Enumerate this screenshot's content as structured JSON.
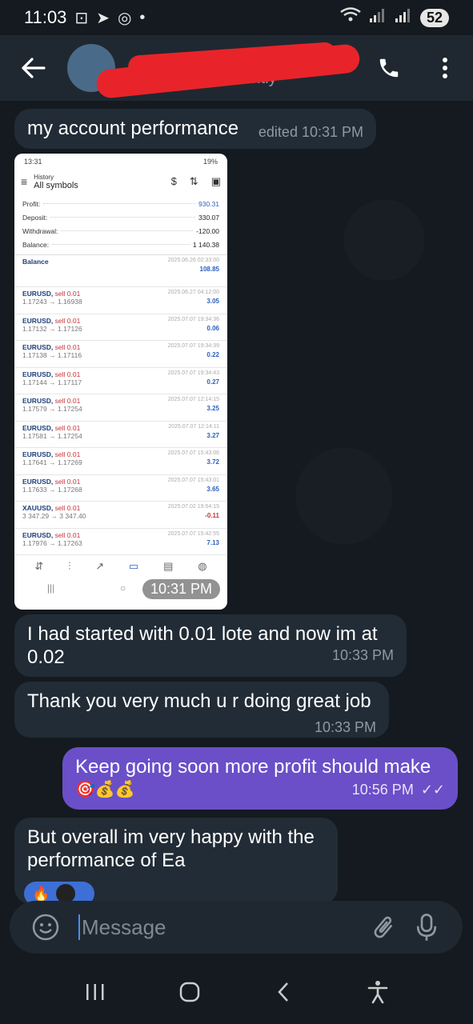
{
  "status_bar": {
    "time": "11:03",
    "battery": "52"
  },
  "header": {
    "last_seen": "last seen recently"
  },
  "messages": [
    {
      "text": "my account performance",
      "time": "edited 10:31 PM"
    },
    {
      "text": "I had started with 0.01 lote and now im at 0.02",
      "time": "10:33 PM"
    },
    {
      "text": "Thank you very much u r doing great job",
      "time": "10:33 PM"
    },
    {
      "text": "Keep going soon more profit should make",
      "emoji": "🎯💰💰",
      "time": "10:56 PM"
    },
    {
      "text": "But overall im very happy with the performance of Ea"
    }
  ],
  "photo": {
    "time": "10:31 PM",
    "status_time": "13:31",
    "status_right": "19%",
    "title_small": "History",
    "title": "All symbols",
    "summary": [
      {
        "label": "Profit:",
        "value": "930.31"
      },
      {
        "label": "Deposit:",
        "value": "330.07"
      },
      {
        "label": "Withdrawal:",
        "value": "-120.00"
      },
      {
        "label": "Balance:",
        "value": "1 140.38"
      }
    ],
    "balance_row": {
      "label": "Balance",
      "date": "2025.06.26 02:33:00",
      "value": "108.85"
    },
    "trades": [
      {
        "sym": "EURUSD,",
        "side": "sell 0.01",
        "prices": "1.17243 → 1.16938",
        "date": "2025.06.27 04:12:00",
        "profit": "3.05"
      },
      {
        "sym": "EURUSD,",
        "side": "sell 0.01",
        "prices": "1.17132 → 1.17126",
        "date": "2025.07.07 19:34:36",
        "profit": "0.06"
      },
      {
        "sym": "EURUSD,",
        "side": "sell 0.01",
        "prices": "1.17138 → 1.17116",
        "date": "2025.07.07 19:34:39",
        "profit": "0.22"
      },
      {
        "sym": "EURUSD,",
        "side": "sell 0.01",
        "prices": "1.17144 → 1.17117",
        "date": "2025.07.07 19:34:43",
        "profit": "0.27"
      },
      {
        "sym": "EURUSD,",
        "side": "sell 0.01",
        "prices": "1.17579 → 1.17254",
        "date": "2025.07.07 12:14:15",
        "profit": "3.25"
      },
      {
        "sym": "EURUSD,",
        "side": "sell 0.01",
        "prices": "1.17581 → 1.17254",
        "date": "2025.07.07 12:14:11",
        "profit": "3.27"
      },
      {
        "sym": "EURUSD,",
        "side": "sell 0.01",
        "prices": "1.17641 → 1.17269",
        "date": "2025.07.07 15:43:06",
        "profit": "3.72"
      },
      {
        "sym": "EURUSD,",
        "side": "sell 0.01",
        "prices": "1.17633 → 1.17268",
        "date": "2025.07.07 15:43:01",
        "profit": "3.65"
      },
      {
        "sym": "XAUUSD,",
        "side": "sell 0.01",
        "prices": "3 347.29 → 3 347.40",
        "date": "2025.07.02 19:54:15",
        "profit": "-0.11"
      },
      {
        "sym": "EURUSD,",
        "side": "sell 0.01",
        "prices": "1.17976 → 1.17263",
        "date": "2025.07.07 15:42:55",
        "profit": "7.13"
      }
    ]
  },
  "reactions": "🔥",
  "input": {
    "placeholder": "Message"
  },
  "colors": {
    "outgoing_bubble": "#6a4fc9",
    "incoming_bubble": "#222c36",
    "header_bg": "#1f2830"
  }
}
